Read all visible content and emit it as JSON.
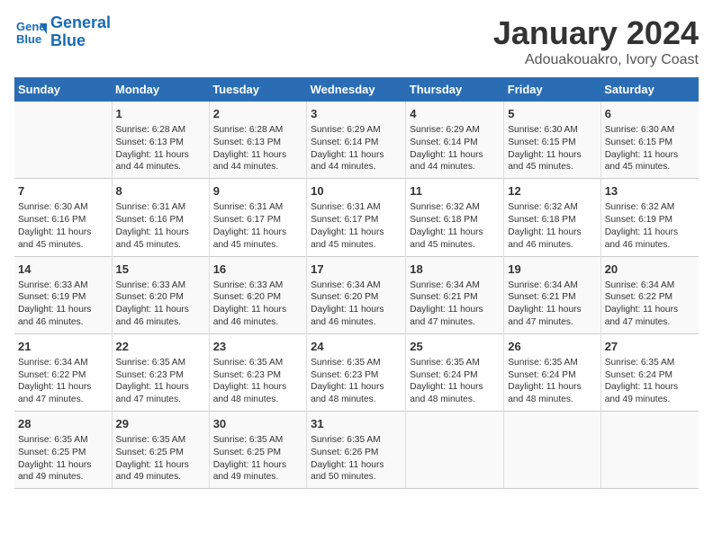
{
  "logo": {
    "line1": "General",
    "line2": "Blue"
  },
  "title": "January 2024",
  "subtitle": "Adouakouakro, Ivory Coast",
  "header": {
    "colors": {
      "blue": "#2a6db5"
    }
  },
  "days_of_week": [
    "Sunday",
    "Monday",
    "Tuesday",
    "Wednesday",
    "Thursday",
    "Friday",
    "Saturday"
  ],
  "weeks": [
    [
      {
        "day": "",
        "content": ""
      },
      {
        "day": "1",
        "content": "Sunrise: 6:28 AM\nSunset: 6:13 PM\nDaylight: 11 hours\nand 44 minutes."
      },
      {
        "day": "2",
        "content": "Sunrise: 6:28 AM\nSunset: 6:13 PM\nDaylight: 11 hours\nand 44 minutes."
      },
      {
        "day": "3",
        "content": "Sunrise: 6:29 AM\nSunset: 6:14 PM\nDaylight: 11 hours\nand 44 minutes."
      },
      {
        "day": "4",
        "content": "Sunrise: 6:29 AM\nSunset: 6:14 PM\nDaylight: 11 hours\nand 44 minutes."
      },
      {
        "day": "5",
        "content": "Sunrise: 6:30 AM\nSunset: 6:15 PM\nDaylight: 11 hours\nand 45 minutes."
      },
      {
        "day": "6",
        "content": "Sunrise: 6:30 AM\nSunset: 6:15 PM\nDaylight: 11 hours\nand 45 minutes."
      }
    ],
    [
      {
        "day": "7",
        "content": "Sunrise: 6:30 AM\nSunset: 6:16 PM\nDaylight: 11 hours\nand 45 minutes."
      },
      {
        "day": "8",
        "content": "Sunrise: 6:31 AM\nSunset: 6:16 PM\nDaylight: 11 hours\nand 45 minutes."
      },
      {
        "day": "9",
        "content": "Sunrise: 6:31 AM\nSunset: 6:17 PM\nDaylight: 11 hours\nand 45 minutes."
      },
      {
        "day": "10",
        "content": "Sunrise: 6:31 AM\nSunset: 6:17 PM\nDaylight: 11 hours\nand 45 minutes."
      },
      {
        "day": "11",
        "content": "Sunrise: 6:32 AM\nSunset: 6:18 PM\nDaylight: 11 hours\nand 45 minutes."
      },
      {
        "day": "12",
        "content": "Sunrise: 6:32 AM\nSunset: 6:18 PM\nDaylight: 11 hours\nand 46 minutes."
      },
      {
        "day": "13",
        "content": "Sunrise: 6:32 AM\nSunset: 6:19 PM\nDaylight: 11 hours\nand 46 minutes."
      }
    ],
    [
      {
        "day": "14",
        "content": "Sunrise: 6:33 AM\nSunset: 6:19 PM\nDaylight: 11 hours\nand 46 minutes."
      },
      {
        "day": "15",
        "content": "Sunrise: 6:33 AM\nSunset: 6:20 PM\nDaylight: 11 hours\nand 46 minutes."
      },
      {
        "day": "16",
        "content": "Sunrise: 6:33 AM\nSunset: 6:20 PM\nDaylight: 11 hours\nand 46 minutes."
      },
      {
        "day": "17",
        "content": "Sunrise: 6:34 AM\nSunset: 6:20 PM\nDaylight: 11 hours\nand 46 minutes."
      },
      {
        "day": "18",
        "content": "Sunrise: 6:34 AM\nSunset: 6:21 PM\nDaylight: 11 hours\nand 47 minutes."
      },
      {
        "day": "19",
        "content": "Sunrise: 6:34 AM\nSunset: 6:21 PM\nDaylight: 11 hours\nand 47 minutes."
      },
      {
        "day": "20",
        "content": "Sunrise: 6:34 AM\nSunset: 6:22 PM\nDaylight: 11 hours\nand 47 minutes."
      }
    ],
    [
      {
        "day": "21",
        "content": "Sunrise: 6:34 AM\nSunset: 6:22 PM\nDaylight: 11 hours\nand 47 minutes."
      },
      {
        "day": "22",
        "content": "Sunrise: 6:35 AM\nSunset: 6:23 PM\nDaylight: 11 hours\nand 47 minutes."
      },
      {
        "day": "23",
        "content": "Sunrise: 6:35 AM\nSunset: 6:23 PM\nDaylight: 11 hours\nand 48 minutes."
      },
      {
        "day": "24",
        "content": "Sunrise: 6:35 AM\nSunset: 6:23 PM\nDaylight: 11 hours\nand 48 minutes."
      },
      {
        "day": "25",
        "content": "Sunrise: 6:35 AM\nSunset: 6:24 PM\nDaylight: 11 hours\nand 48 minutes."
      },
      {
        "day": "26",
        "content": "Sunrise: 6:35 AM\nSunset: 6:24 PM\nDaylight: 11 hours\nand 48 minutes."
      },
      {
        "day": "27",
        "content": "Sunrise: 6:35 AM\nSunset: 6:24 PM\nDaylight: 11 hours\nand 49 minutes."
      }
    ],
    [
      {
        "day": "28",
        "content": "Sunrise: 6:35 AM\nSunset: 6:25 PM\nDaylight: 11 hours\nand 49 minutes."
      },
      {
        "day": "29",
        "content": "Sunrise: 6:35 AM\nSunset: 6:25 PM\nDaylight: 11 hours\nand 49 minutes."
      },
      {
        "day": "30",
        "content": "Sunrise: 6:35 AM\nSunset: 6:25 PM\nDaylight: 11 hours\nand 49 minutes."
      },
      {
        "day": "31",
        "content": "Sunrise: 6:35 AM\nSunset: 6:26 PM\nDaylight: 11 hours\nand 50 minutes."
      },
      {
        "day": "",
        "content": ""
      },
      {
        "day": "",
        "content": ""
      },
      {
        "day": "",
        "content": ""
      }
    ]
  ]
}
